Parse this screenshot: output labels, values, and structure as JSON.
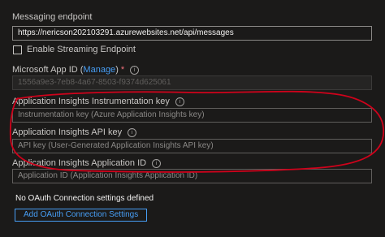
{
  "messaging_endpoint": {
    "label": "Messaging endpoint",
    "value": "https://nericson202103291.azurewebsites.net/api/messages"
  },
  "streaming": {
    "label": "Enable Streaming Endpoint"
  },
  "app_id": {
    "label": "Microsoft App ID (",
    "manage_link": "Manage",
    "label_close": ")",
    "required_mark": "*",
    "value": "1556a9e3-7eb8-4a67-8503-f9374d625061"
  },
  "instrumentation_key": {
    "label": "Application Insights Instrumentation key",
    "placeholder": "Instrumentation key (Azure Application Insights key)"
  },
  "api_key": {
    "label": "Application Insights API key",
    "placeholder": "API key (User-Generated Application Insights API key)"
  },
  "application_id": {
    "label": "Application Insights Application ID",
    "placeholder": "Application ID (Application Insights Application ID)"
  },
  "oauth": {
    "empty_text": "No OAuth Connection settings defined",
    "add_button": "Add OAuth Connection Settings"
  },
  "colors": {
    "background": "#1b1a19",
    "link": "#479ef5",
    "annotation": "#d0021b"
  },
  "icons": {
    "info": "info-icon"
  }
}
